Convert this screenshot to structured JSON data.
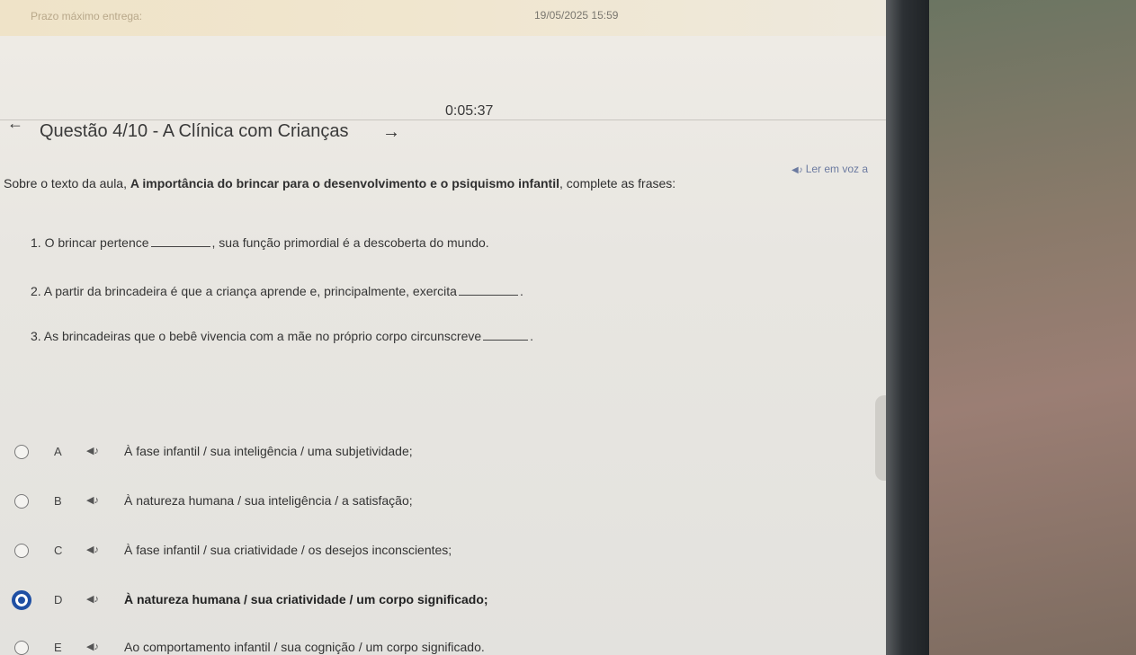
{
  "header": {
    "deadline_label": "Prazo máximo entrega:",
    "deadline_value": "19/05/2025 15:59",
    "timer": "0:05:37"
  },
  "question": {
    "title": "Questão 4/10 - A Clínica com Crianças",
    "read_aloud": "Ler em voz a",
    "prompt_before": "Sobre o texto da aula, ",
    "prompt_bold": "A importância do brincar para o desenvolvimento e o psiquismo infantil",
    "prompt_after": ", complete as frases:",
    "items": [
      {
        "before": "1. O brincar pertence",
        "after": ", sua função primordial é a descoberta do mundo."
      },
      {
        "before": "2. A partir da brincadeira é que a criança aprende e, principalmente, exercita",
        "after": "."
      },
      {
        "before": "3. As brincadeiras que o bebê vivencia com a mãe no próprio corpo circunscreve",
        "after": "."
      }
    ]
  },
  "options": [
    {
      "letter": "A",
      "text": "À fase infantil / sua inteligência / uma subjetividade;",
      "selected": false
    },
    {
      "letter": "B",
      "text": "À natureza humana / sua inteligência / a satisfação;",
      "selected": false
    },
    {
      "letter": "C",
      "text": "À fase infantil / sua criatividade / os desejos inconscientes;",
      "selected": false
    },
    {
      "letter": "D",
      "text": "À natureza humana / sua criatividade / um corpo significado;",
      "selected": true
    },
    {
      "letter": "E",
      "text": "Ao comportamento infantil / sua cognição / um corpo significado.",
      "selected": false
    }
  ],
  "icons": {
    "back": "arrow-left-icon",
    "next": "arrow-right-icon",
    "speaker": "speaker-icon"
  },
  "colors": {
    "selected_radio": "#1f4fa3",
    "read_aloud": "#6b7aa0"
  }
}
